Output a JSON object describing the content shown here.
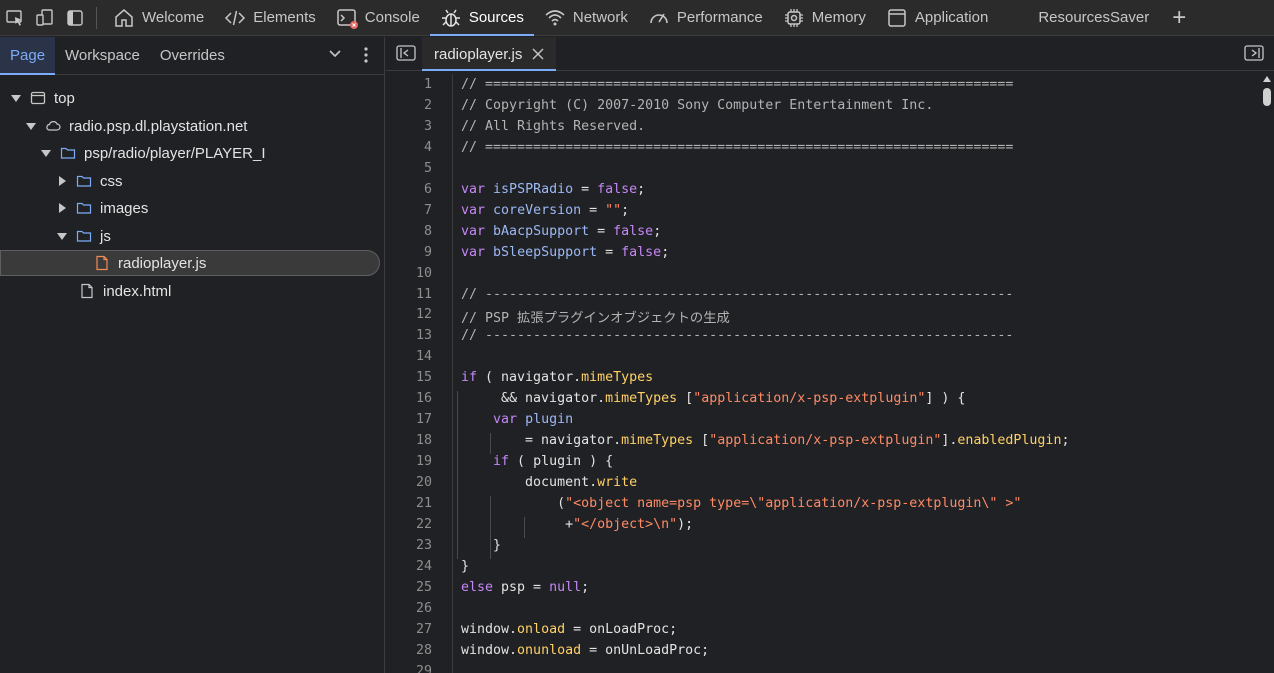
{
  "toolbar": {
    "tabs": [
      {
        "label": "Welcome",
        "icon": "home-icon"
      },
      {
        "label": "Elements",
        "icon": "code-tags-icon"
      },
      {
        "label": "Console",
        "icon": "console-icon"
      },
      {
        "label": "Sources",
        "icon": "bug-icon"
      },
      {
        "label": "Network",
        "icon": "wifi-icon"
      },
      {
        "label": "Performance",
        "icon": "gauge-icon"
      },
      {
        "label": "Memory",
        "icon": "chip-icon"
      },
      {
        "label": "Application",
        "icon": "window-icon"
      },
      {
        "label": "ResourcesSaver",
        "icon": ""
      }
    ],
    "active_tab": "Sources",
    "add_label": "+",
    "accent": "#7cacf8"
  },
  "navigator": {
    "tabs": [
      "Page",
      "Workspace",
      "Overrides"
    ],
    "active": "Page",
    "tree": [
      {
        "label": "top",
        "icon": "frame-icon",
        "expanded": true
      },
      {
        "label": "radio.psp.dl.playstation.net",
        "icon": "cloud-icon",
        "expanded": true
      },
      {
        "label": "psp/radio/player/PLAYER_I",
        "icon": "folder-icon",
        "expanded": true
      },
      {
        "label": "css",
        "icon": "folder-icon",
        "expanded": false
      },
      {
        "label": "images",
        "icon": "folder-icon",
        "expanded": false
      },
      {
        "label": "js",
        "icon": "folder-icon",
        "expanded": true
      },
      {
        "label": "radioplayer.js",
        "icon": "js-file-icon",
        "selected": true
      },
      {
        "label": "index.html",
        "icon": "file-icon"
      }
    ]
  },
  "editor": {
    "open_file": "radioplayer.js",
    "lines": [
      "// ==================================================================",
      "// Copyright (C) 2007-2010 Sony Computer Entertainment Inc.",
      "// All Rights Reserved.",
      "// ==================================================================",
      "",
      "var isPSPRadio = false;",
      "var coreVersion = \"\";",
      "var bAacpSupport = false;",
      "var bSleepSupport = false;",
      "",
      "// ------------------------------------------------------------------",
      "// PSP 拡張プラグインオブジェクトの生成",
      "// ------------------------------------------------------------------",
      "",
      "if ( navigator.mimeTypes",
      "     && navigator.mimeTypes [\"application/x-psp-extplugin\"] ) {",
      "    var plugin",
      "        = navigator.mimeTypes [\"application/x-psp-extplugin\"].enabledPlugin;",
      "    if ( plugin ) {",
      "        document.write",
      "            (\"<object name=psp type=\\\"application/x-psp-extplugin\\\" >\"",
      "             +\"</object>\\n\");",
      "    }",
      "}",
      "else psp = null;",
      "",
      "window.onload = onLoadProc;",
      "window.onunload = onUnLoadProc;",
      ""
    ]
  }
}
